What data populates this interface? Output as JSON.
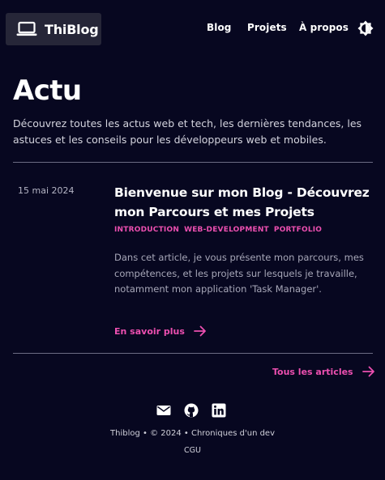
{
  "header": {
    "brand": "ThiBlog",
    "nav": [
      "Blog",
      "Projets",
      "À propos"
    ],
    "logo_icon": "laptop-icon",
    "theme_icon": "brightness-icon"
  },
  "page": {
    "title": "Actu",
    "intro": "Découvrez toutes les actus web et tech, les dernières tendances, les astuces et les conseils pour les développeurs web et mobiles."
  },
  "article": {
    "date": "15 mai 2024",
    "title": "Bienvenue sur mon Blog - Découvrez mon Parcours et mes Projets",
    "tags": [
      "INTRODUCTION",
      "WEB-DEVELOPMENT",
      "PORTFOLIO"
    ],
    "excerpt": "Dans cet article, je vous présente mon parcours, mes compétences, et les projets sur lesquels je travaille, notamment mon application 'Task Manager'.",
    "read_more": "En savoir plus"
  },
  "all_articles": "Tous les articles",
  "footer": {
    "social_icons": [
      "mail-icon",
      "github-icon",
      "linkedin-icon"
    ],
    "copyright": "Thiblog • © 2024 • Chroniques d'un dev",
    "cgu": "CGU"
  },
  "colors": {
    "background": "#070720",
    "accent": "#ec4fb0",
    "logo_bg": "#262638",
    "divider": "#6c6c84"
  }
}
